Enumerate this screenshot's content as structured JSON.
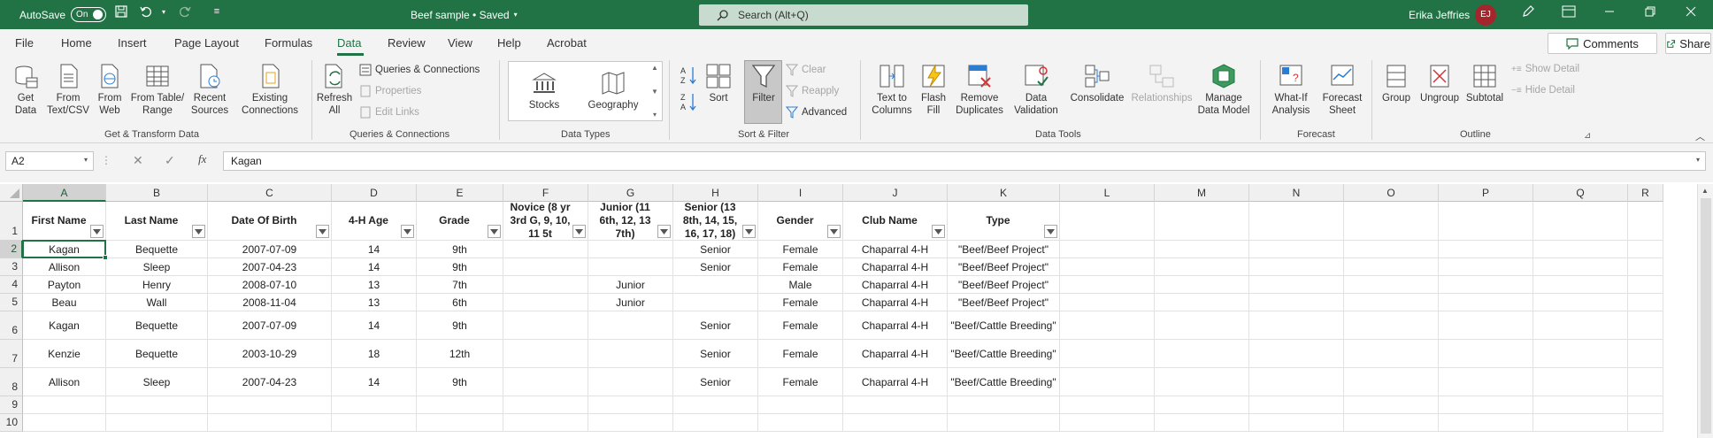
{
  "titlebar": {
    "autosave_label": "AutoSave",
    "autosave_state": "On",
    "doc_title": "Beef sample • Saved",
    "search_placeholder": "Search (Alt+Q)",
    "user_name": "Erika Jeffries",
    "user_initials": "EJ"
  },
  "menu": {
    "items": [
      "File",
      "Home",
      "Insert",
      "Page Layout",
      "Formulas",
      "Data",
      "Review",
      "View",
      "Help",
      "Acrobat"
    ],
    "active": "Data",
    "comments_label": "Comments",
    "share_label": "Share"
  },
  "ribbon": {
    "get_data": "Get Data",
    "from_text_csv": "From Text/CSV",
    "from_web": "From Web",
    "from_table_range": "From Table/ Range",
    "recent_sources": "Recent Sources",
    "existing_connections": "Existing Connections",
    "group_get_transform": "Get & Transform Data",
    "refresh_all": "Refresh All",
    "queries_connections": "Queries & Connections",
    "properties": "Properties",
    "edit_links": "Edit Links",
    "group_queries": "Queries & Connections",
    "stocks": "Stocks",
    "geography": "Geography",
    "group_data_types": "Data Types",
    "sort": "Sort",
    "filter": "Filter",
    "clear": "Clear",
    "reapply": "Reapply",
    "advanced": "Advanced",
    "group_sort_filter": "Sort & Filter",
    "text_to_columns": "Text to Columns",
    "flash_fill": "Flash Fill",
    "remove_duplicates": "Remove Duplicates",
    "data_validation": "Data Validation",
    "consolidate": "Consolidate",
    "relationships": "Relationships",
    "manage_data_model": "Manage Data Model",
    "group_data_tools": "Data Tools",
    "what_if": "What-If Analysis",
    "forecast_sheet": "Forecast Sheet",
    "group_forecast": "Forecast",
    "group": "Group",
    "ungroup": "Ungroup",
    "subtotal": "Subtotal",
    "show_detail": "Show Detail",
    "hide_detail": "Hide Detail",
    "group_outline": "Outline"
  },
  "formula_bar": {
    "name_box": "A2",
    "formula": "Kagan"
  },
  "grid": {
    "columns": [
      "A",
      "B",
      "C",
      "D",
      "E",
      "F",
      "G",
      "H",
      "I",
      "J",
      "K",
      "L",
      "M",
      "N",
      "O",
      "P",
      "Q",
      "R"
    ],
    "rows": [
      "1",
      "2",
      "3",
      "4",
      "5",
      "6",
      "7",
      "8",
      "9",
      "10"
    ],
    "headers": [
      "First Name",
      "Last Name",
      "Date Of Birth",
      "4-H Age",
      "Grade",
      "Novice (8 yr 3rd G, 9, 10, 11 5t",
      "Junior (11 6th, 12, 13 7th)",
      "Senior (13 8th, 14, 15, 16, 17, 18)",
      "Gender",
      "Club Name",
      "Type"
    ],
    "data": [
      [
        "Kagan",
        "Bequette",
        "2007-07-09",
        "14",
        "9th",
        "",
        "",
        "Senior",
        "Female",
        "Chaparral 4-H",
        "\"Beef/Beef Project\""
      ],
      [
        "Allison",
        "Sleep",
        "2007-04-23",
        "14",
        "9th",
        "",
        "",
        "Senior",
        "Female",
        "Chaparral 4-H",
        "\"Beef/Beef Project\""
      ],
      [
        "Payton",
        "Henry",
        "2008-07-10",
        "13",
        "7th",
        "",
        "Junior",
        "",
        "Male",
        "Chaparral 4-H",
        "\"Beef/Beef Project\""
      ],
      [
        "Beau",
        "Wall",
        "2008-11-04",
        "13",
        "6th",
        "",
        "Junior",
        "",
        "Female",
        "Chaparral 4-H",
        "\"Beef/Beef Project\""
      ],
      [
        "Kagan",
        "Bequette",
        "2007-07-09",
        "14",
        "9th",
        "",
        "",
        "Senior",
        "Female",
        "Chaparral 4-H",
        "\"Beef/Cattle Breeding\""
      ],
      [
        "Kenzie",
        "Bequette",
        "2003-10-29",
        "18",
        "12th",
        "",
        "",
        "Senior",
        "Female",
        "Chaparral 4-H",
        "\"Beef/Cattle Breeding\""
      ],
      [
        "Allison",
        "Sleep",
        "2007-04-23",
        "14",
        "9th",
        "",
        "",
        "Senior",
        "Female",
        "Chaparral 4-H",
        "\"Beef/Cattle Breeding\""
      ]
    ]
  }
}
